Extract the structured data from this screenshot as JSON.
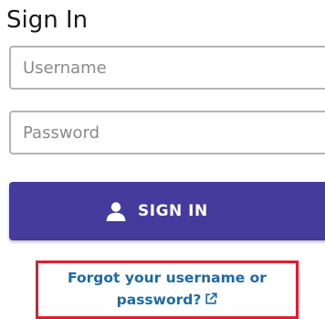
{
  "form": {
    "title": "Sign In",
    "username_placeholder": "Username",
    "password_placeholder": "Password",
    "username_value": "",
    "password_value": "",
    "submit_label": "SIGN IN",
    "submit_icon": "user-icon",
    "forgot_line1": "Forgot your username or",
    "forgot_line2": "password?",
    "forgot_icon": "external-link-icon"
  },
  "colors": {
    "button_bg": "#453b9c",
    "link": "#1a6aa6",
    "highlight_border": "#e8192c",
    "input_border": "#b5b5b5"
  }
}
